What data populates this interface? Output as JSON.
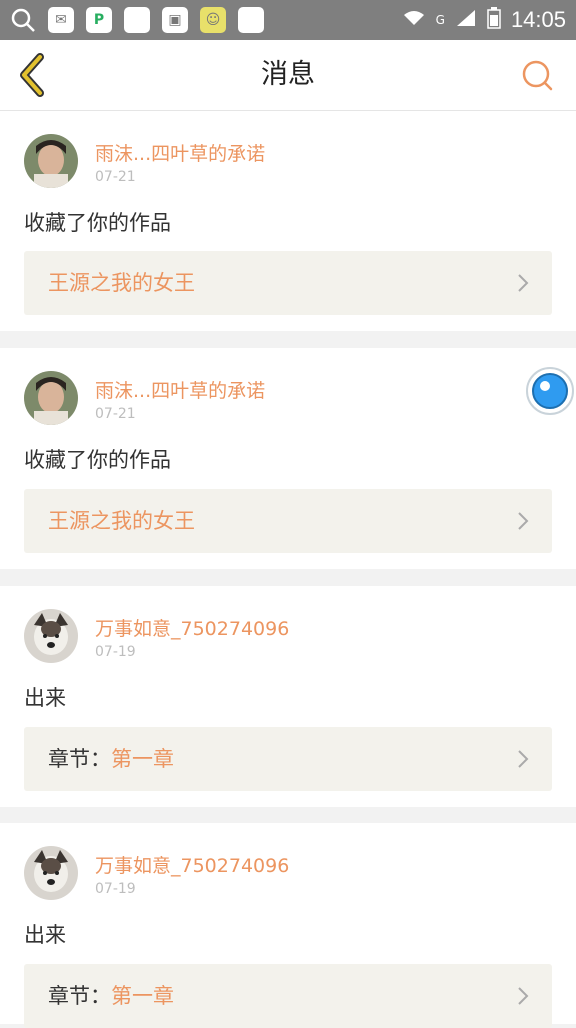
{
  "status_bar": {
    "time": "14:05",
    "network": "G"
  },
  "header": {
    "title": "消息"
  },
  "messages": [
    {
      "user": "雨沫...四叶草的承诺",
      "date": "07-21",
      "text": "收藏了你的作品",
      "link_prefix": "",
      "link_text": "王源之我的女王"
    },
    {
      "user": "雨沫...四叶草的承诺",
      "date": "07-21",
      "text": "收藏了你的作品",
      "link_prefix": "",
      "link_text": "王源之我的女王"
    },
    {
      "user": "万事如意_750274096",
      "date": "07-19",
      "text": "出来",
      "link_prefix": "章节：",
      "link_text": "第一章"
    },
    {
      "user": "万事如意_750274096",
      "date": "07-19",
      "text": "出来",
      "link_prefix": "章节：",
      "link_text": "第一章"
    }
  ],
  "colors": {
    "accent": "#ec9560",
    "back_arrow": "#e2c12e",
    "float_button": "#2f9bf0",
    "link_bg": "#f3f2ec"
  }
}
